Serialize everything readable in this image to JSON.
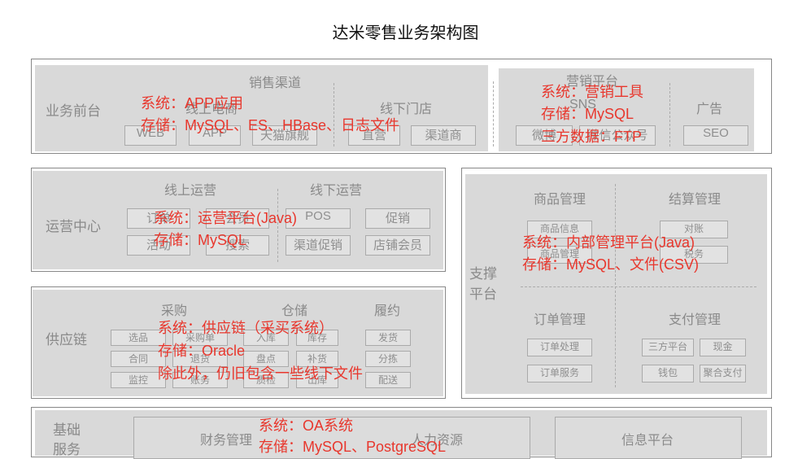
{
  "title": "达米零售业务架构图",
  "colors": {
    "annotation": "#e8372d",
    "block": "#d9d9d9",
    "border": "#888888"
  },
  "front": {
    "label": "业务前台",
    "sales": {
      "title": "销售渠道",
      "online": "线上电商",
      "offline": "线下门店",
      "buttons": [
        "WEB",
        "APP",
        "天猫旗舰",
        "直营",
        "渠道商"
      ]
    },
    "marketing": {
      "title": "营销平台",
      "sns": "SNS",
      "ads": "广告",
      "buttons": [
        "微博",
        "微信公众号",
        "SEO"
      ]
    },
    "note_sales": [
      "系统：APP应用",
      "存储：MySQL、ES、HBase、日志文件"
    ],
    "note_marketing": [
      "系统：营销工具",
      "存储：MySQL",
      "三方数据：FTP"
    ]
  },
  "ops": {
    "label": "运营中心",
    "online": "线上运营",
    "offline": "线下运营",
    "buttons": [
      "订单",
      "会员",
      "POS",
      "促销",
      "活动",
      "搜索",
      "渠道促销",
      "店铺会员"
    ],
    "note": [
      "系统：运营平台(Java)",
      "存储：MySQL"
    ]
  },
  "supply": {
    "label": "供应链",
    "purchase": "采购",
    "storage": "仓储",
    "fulfill": "履约",
    "buttons": [
      "选品",
      "采购单",
      "入库",
      "库存",
      "发货",
      "合同",
      "退货",
      "盘点",
      "补货",
      "分拣",
      "监控",
      "账务",
      "质检",
      "出库",
      "配送"
    ],
    "note": [
      "系统：供应链（采买系统）",
      "存储：Oracle",
      "除此外，仍旧包含一些线下文件"
    ]
  },
  "support": {
    "label_1": "支撑",
    "label_2": "平台",
    "goods": "商品管理",
    "settle": "结算管理",
    "order": "订单管理",
    "pay": "支付管理",
    "goods_buttons": [
      "商品信息",
      "商品管理"
    ],
    "settle_buttons": [
      "对账",
      "税务"
    ],
    "order_buttons": [
      "订单处理",
      "订单服务"
    ],
    "pay_buttons": [
      "三方平台",
      "现金",
      "钱包",
      "聚合支付"
    ],
    "note": [
      "系统：内部管理平台(Java)",
      "存储：MySQL、文件(CSV)"
    ]
  },
  "base": {
    "label_1": "基础",
    "label_2": "服务",
    "finance": "财务管理",
    "hr": "人力资源",
    "info": "信息平台",
    "note": [
      "系统：OA系统",
      "存储：MySQL、PostgreSQL"
    ]
  }
}
